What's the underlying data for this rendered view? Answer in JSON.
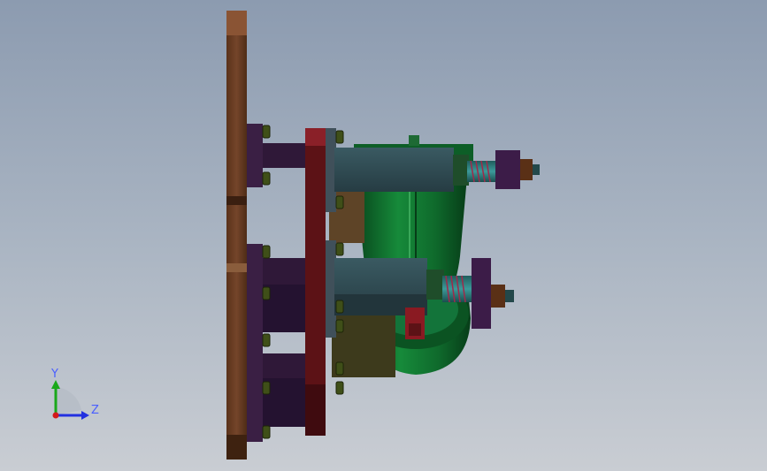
{
  "viewport": {
    "triad": {
      "y_label": "Y",
      "z_label": "Z"
    }
  },
  "colors": {
    "background_top": "#8c9bb0",
    "background_bottom": "#c9cdd3",
    "base_plate": "#6b3e22",
    "flange": "#3a1f3f",
    "frame_plate": "#5c1216",
    "block": "#2f4a52",
    "housing": "#0f6a2c",
    "bracket": "#4a3e22",
    "spring": "#2f7a7a",
    "nut": "#5a3016",
    "bolt": "#2c3a12"
  }
}
